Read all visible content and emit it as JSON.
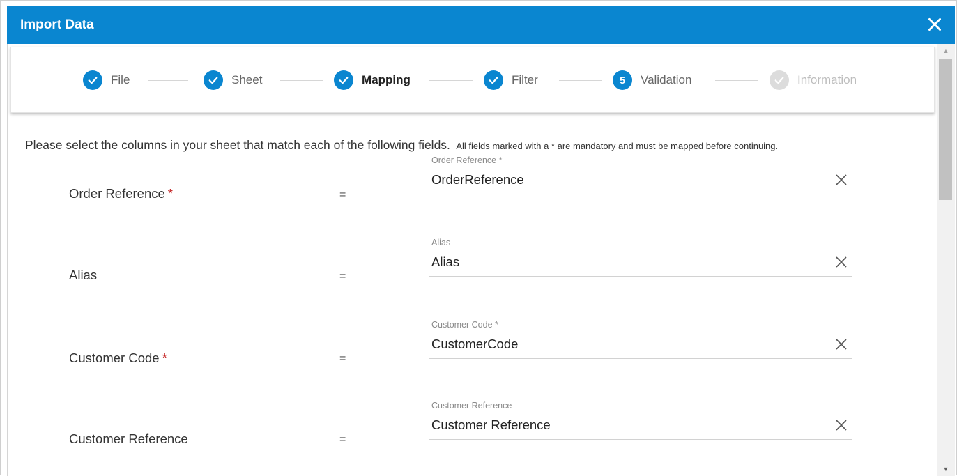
{
  "dialog": {
    "title": "Import Data",
    "close_icon": "close-icon"
  },
  "stepper": {
    "steps": [
      {
        "label": "File",
        "state": "completed",
        "icon": "check-icon"
      },
      {
        "label": "Sheet",
        "state": "completed",
        "icon": "check-icon"
      },
      {
        "label": "Mapping",
        "state": "completed",
        "icon": "check-icon"
      },
      {
        "label": "Filter",
        "state": "completed",
        "icon": "check-icon"
      },
      {
        "label": "Validation",
        "state": "current",
        "number": "5"
      },
      {
        "label": "Information",
        "state": "disabled",
        "icon": "check-icon"
      }
    ]
  },
  "instructions": {
    "main": "Please select the columns in your sheet that match each of the following fields.",
    "note": "All fields marked with a * are mandatory and must be mapped before continuing."
  },
  "mapping": {
    "equals": "=",
    "required_mark": "*",
    "rows": [
      {
        "label": "Order Reference",
        "required": true,
        "field_label": "Order Reference *",
        "value": "OrderReference"
      },
      {
        "label": "Alias",
        "required": false,
        "field_label": "Alias",
        "value": "Alias"
      },
      {
        "label": "Customer Code",
        "required": true,
        "field_label": "Customer Code *",
        "value": "CustomerCode"
      },
      {
        "label": "Customer Reference",
        "required": false,
        "field_label": "Customer Reference",
        "value": "Customer Reference"
      }
    ]
  },
  "colors": {
    "accent": "#0a86d0",
    "required": "#c62828",
    "disabled": "#dcdcdc"
  }
}
